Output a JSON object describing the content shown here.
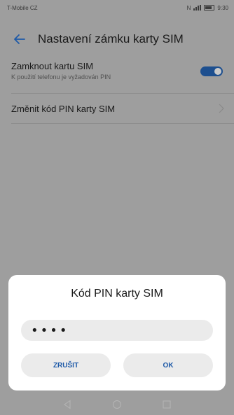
{
  "status_bar": {
    "carrier": "T-Mobile CZ",
    "time": "9:30",
    "icons": [
      "nfc-icon",
      "signal-icon",
      "battery-icon"
    ]
  },
  "app_bar": {
    "title": "Nastavení zámku karty SIM",
    "back_icon": "arrow-left-icon"
  },
  "settings": {
    "lock_sim": {
      "title": "Zamknout kartu SIM",
      "subtitle": "K použití telefonu je vyžadován PIN",
      "enabled": true
    },
    "change_pin": {
      "title": "Změnit kód PIN karty SIM"
    }
  },
  "dialog": {
    "title": "Kód PIN karty SIM",
    "pin_value": "••••",
    "cancel_label": "ZRUŠIT",
    "ok_label": "OK"
  },
  "nav_bar": {
    "buttons": [
      "back-icon",
      "home-icon",
      "recents-icon"
    ]
  },
  "colors": {
    "accent": "#1e5aa8",
    "toggle_on": "#1d4f8f",
    "scrim_background": "#9e9e9e",
    "dialog_background": "#ffffff"
  }
}
